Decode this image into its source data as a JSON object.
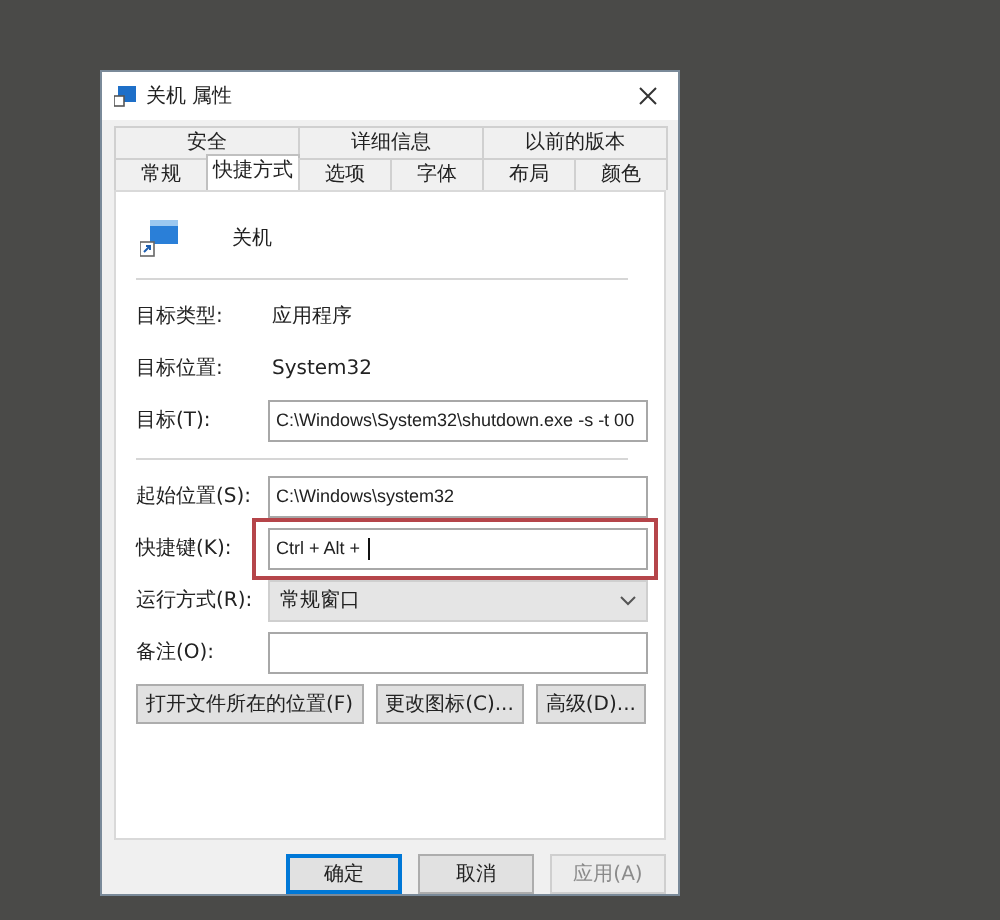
{
  "window": {
    "title": "关机 属性"
  },
  "tab_rows": [
    [
      {
        "label": "安全",
        "selected": false
      },
      {
        "label": "详细信息",
        "selected": false
      },
      {
        "label": "以前的版本",
        "selected": false
      }
    ],
    [
      {
        "label": "常规",
        "selected": false
      },
      {
        "label": "快捷方式",
        "selected": true
      },
      {
        "label": "选项",
        "selected": false
      },
      {
        "label": "字体",
        "selected": false
      },
      {
        "label": "布局",
        "selected": false
      },
      {
        "label": "颜色",
        "selected": false
      }
    ]
  ],
  "shortcut": {
    "name": "关机"
  },
  "fields": [
    {
      "kind": "text",
      "label": "目标类型:",
      "value": "应用程序"
    },
    {
      "kind": "text",
      "label": "目标位置:",
      "value": "System32"
    },
    {
      "kind": "input",
      "label": "目标(T):",
      "value": "C:\\Windows\\System32\\shutdown.exe -s -t 00",
      "highlighted": false,
      "focused": false
    },
    {
      "kind": "separator"
    },
    {
      "kind": "input",
      "label": "起始位置(S):",
      "value": "C:\\Windows\\system32",
      "highlighted": false,
      "focused": false
    },
    {
      "kind": "input",
      "label": "快捷键(K):",
      "value": "Ctrl + Alt + ",
      "highlighted": true,
      "focused": true
    },
    {
      "kind": "select",
      "label": "运行方式(R):",
      "value": "常规窗口"
    },
    {
      "kind": "input",
      "label": "备注(O):",
      "highlighted": false,
      "focused": false
    }
  ],
  "action_buttons": [
    "打开文件所在的位置(F)",
    "更改图标(C)...",
    "高级(D)..."
  ],
  "dialog_buttons": [
    {
      "label": "确定",
      "default": true,
      "disabled": false
    },
    {
      "label": "取消",
      "default": false,
      "disabled": false
    },
    {
      "label": "应用(A)",
      "default": false,
      "disabled": true
    }
  ]
}
